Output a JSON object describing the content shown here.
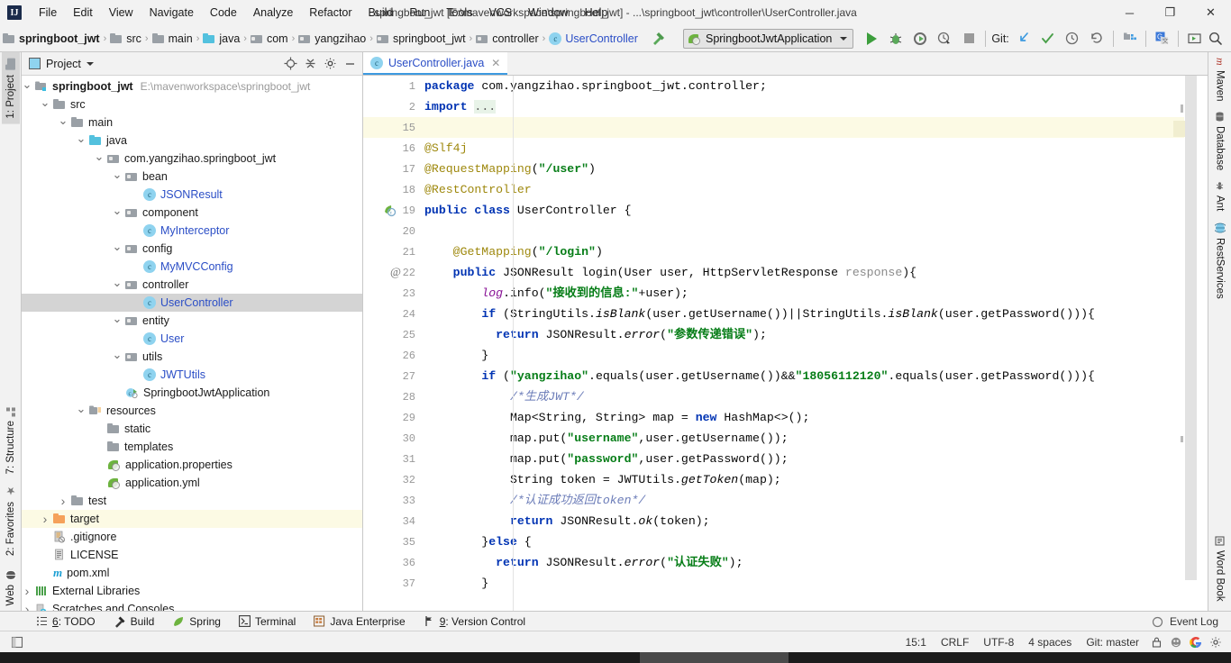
{
  "window": {
    "title": "springboot_jwt [E:\\mavenworkspace\\springboot_jwt] - ...\\springboot_jwt\\controller\\UserController.java",
    "minimize": "─",
    "maximize": "❐",
    "close": "✕",
    "logo": "IJ"
  },
  "menubar": {
    "items": [
      {
        "label": "File",
        "mnemonic": "F"
      },
      {
        "label": "Edit",
        "mnemonic": "E"
      },
      {
        "label": "View",
        "mnemonic": "V"
      },
      {
        "label": "Navigate",
        "mnemonic": "N"
      },
      {
        "label": "Code",
        "mnemonic": "C"
      },
      {
        "label": "Analyze",
        "mnemonic": "z"
      },
      {
        "label": "Refactor",
        "mnemonic": "R"
      },
      {
        "label": "Build",
        "mnemonic": "B"
      },
      {
        "label": "Run",
        "mnemonic": "u"
      },
      {
        "label": "Tools",
        "mnemonic": "T"
      },
      {
        "label": "VCS",
        "mnemonic": "S"
      },
      {
        "label": "Window",
        "mnemonic": "W"
      },
      {
        "label": "Help",
        "mnemonic": "H"
      }
    ]
  },
  "breadcrumbs": [
    {
      "label": "springboot_jwt",
      "icon": "folder-project-icon",
      "style": "bold"
    },
    {
      "label": "src",
      "icon": "folder-icon",
      "style": "normal"
    },
    {
      "label": "main",
      "icon": "folder-icon",
      "style": "normal"
    },
    {
      "label": "java",
      "icon": "folder-source-icon",
      "style": "normal"
    },
    {
      "label": "com",
      "icon": "package-icon",
      "style": "normal"
    },
    {
      "label": "yangzihao",
      "icon": "package-icon",
      "style": "normal"
    },
    {
      "label": "springboot_jwt",
      "icon": "package-icon",
      "style": "normal"
    },
    {
      "label": "controller",
      "icon": "package-icon",
      "style": "normal"
    },
    {
      "label": "UserController",
      "icon": "class-icon",
      "style": "blue"
    }
  ],
  "toolbar": {
    "run_config": "SpringbootJwtApplication",
    "git_label": "Git:",
    "buttons": [
      {
        "name": "build-hammer-icon",
        "title": "Build"
      },
      {
        "name": "run-button",
        "title": "Run"
      },
      {
        "name": "debug-button",
        "title": "Debug"
      },
      {
        "name": "run-with-coverage-button",
        "title": "Run with Coverage"
      },
      {
        "name": "profile-button",
        "title": "Profile"
      },
      {
        "name": "stop-button",
        "title": "Stop"
      },
      {
        "name": "git-update-project-icon",
        "title": "Update Project"
      },
      {
        "name": "git-commit-icon",
        "title": "Commit"
      },
      {
        "name": "git-history-icon",
        "title": "History"
      },
      {
        "name": "git-rollback-icon",
        "title": "Rollback"
      },
      {
        "name": "project-structure-icon",
        "title": "Project Structure"
      },
      {
        "name": "translate-icon",
        "title": "Translate"
      },
      {
        "name": "presentation-icon",
        "title": "Presentation"
      },
      {
        "name": "search-everywhere-icon",
        "title": "Search Everywhere"
      }
    ]
  },
  "left_rail": {
    "top": [
      {
        "label": "1: Project",
        "mnemonic": "1",
        "icon": "project-folder-icon",
        "selected": true
      }
    ],
    "bottom": [
      {
        "label": "7: Structure",
        "mnemonic": "7",
        "icon": "structure-icon"
      },
      {
        "label": "2: Favorites",
        "mnemonic": "2",
        "icon": "star-icon"
      },
      {
        "label": "Web",
        "icon": "web-globe-icon"
      }
    ]
  },
  "right_rail": {
    "items": [
      {
        "label": "Maven",
        "icon": "maven-icon"
      },
      {
        "label": "Database",
        "icon": "database-icon"
      },
      {
        "label": "Ant",
        "icon": "ant-icon"
      },
      {
        "label": "RestServices",
        "icon": "rest-services-icon"
      },
      {
        "label": "Word Book",
        "icon": "word-book-icon"
      }
    ]
  },
  "project_pane": {
    "title": "Project",
    "header_buttons": [
      {
        "name": "scroll-from-source-icon"
      },
      {
        "name": "collapse-all-icon"
      },
      {
        "name": "settings-gear-icon"
      },
      {
        "name": "hide-icon"
      }
    ],
    "tree": [
      {
        "label": "springboot_jwt",
        "path": "E:\\mavenworkspace\\springboot_jwt",
        "depth": 0,
        "arrow": "d",
        "icon": "module-icon",
        "bold": true
      },
      {
        "label": "src",
        "depth": 1,
        "arrow": "d",
        "icon": "folder-icon"
      },
      {
        "label": "main",
        "depth": 2,
        "arrow": "d",
        "icon": "folder-icon"
      },
      {
        "label": "java",
        "depth": 3,
        "arrow": "d",
        "icon": "folder-source-icon"
      },
      {
        "label": "com.yangzihao.springboot_jwt",
        "depth": 4,
        "arrow": "d",
        "icon": "package-icon"
      },
      {
        "label": "bean",
        "depth": 5,
        "arrow": "d",
        "icon": "package-icon"
      },
      {
        "label": "JSONResult",
        "depth": 6,
        "arrow": "",
        "icon": "class-icon",
        "blue": true
      },
      {
        "label": "component",
        "depth": 5,
        "arrow": "d",
        "icon": "package-icon"
      },
      {
        "label": "MyInterceptor",
        "depth": 6,
        "arrow": "",
        "icon": "class-icon",
        "blue": true
      },
      {
        "label": "config",
        "depth": 5,
        "arrow": "d",
        "icon": "package-icon"
      },
      {
        "label": "MyMVCConfig",
        "depth": 6,
        "arrow": "",
        "icon": "class-icon",
        "blue": true
      },
      {
        "label": "controller",
        "depth": 5,
        "arrow": "d",
        "icon": "package-icon"
      },
      {
        "label": "UserController",
        "depth": 6,
        "arrow": "",
        "icon": "class-icon",
        "blue": true,
        "selected": true
      },
      {
        "label": "entity",
        "depth": 5,
        "arrow": "d",
        "icon": "package-icon"
      },
      {
        "label": "User",
        "depth": 6,
        "arrow": "",
        "icon": "class-icon",
        "blue": true
      },
      {
        "label": "utils",
        "depth": 5,
        "arrow": "d",
        "icon": "package-icon"
      },
      {
        "label": "JWTUtils",
        "depth": 6,
        "arrow": "",
        "icon": "class-icon",
        "blue": true
      },
      {
        "label": "SpringbootJwtApplication",
        "depth": 5,
        "arrow": "",
        "icon": "spring-class-icon"
      },
      {
        "label": "resources",
        "depth": 3,
        "arrow": "d",
        "icon": "folder-resources-icon"
      },
      {
        "label": "static",
        "depth": 4,
        "arrow": "",
        "icon": "folder-icon"
      },
      {
        "label": "templates",
        "depth": 4,
        "arrow": "",
        "icon": "folder-icon"
      },
      {
        "label": "application.properties",
        "depth": 4,
        "arrow": "",
        "icon": "spring-config-icon"
      },
      {
        "label": "application.yml",
        "depth": 4,
        "arrow": "",
        "icon": "spring-config-icon"
      },
      {
        "label": "test",
        "depth": 2,
        "arrow": "r",
        "icon": "folder-icon"
      },
      {
        "label": "target",
        "depth": 1,
        "arrow": "r",
        "icon": "folder-excluded-icon",
        "highlight": true
      },
      {
        "label": ".gitignore",
        "depth": 1,
        "arrow": "",
        "icon": "gitignore-icon"
      },
      {
        "label": "LICENSE",
        "depth": 1,
        "arrow": "",
        "icon": "text-file-icon"
      },
      {
        "label": "pom.xml",
        "depth": 1,
        "arrow": "",
        "icon": "maven-pom-icon"
      },
      {
        "label": "External Libraries",
        "depth": 0,
        "arrow": "r",
        "icon": "libraries-icon"
      },
      {
        "label": "Scratches and Consoles",
        "depth": 0,
        "arrow": "r",
        "icon": "scratches-icon"
      }
    ]
  },
  "editor": {
    "tab": {
      "label": "UserController.java",
      "icon": "class-icon",
      "close": "✕"
    },
    "lines": [
      {
        "num": "1",
        "fold": "run",
        "html": "<span class='kw'>package</span> com.yangzihao.springboot_jwt.controller;"
      },
      {
        "num": "2",
        "fold": "plus",
        "html": "<span class='kw'>import</span> <span class='importdots'>...</span>"
      },
      {
        "num": "15",
        "fold": "",
        "html": "",
        "highlight": true
      },
      {
        "num": "16",
        "fold": "minus",
        "html": "<span class='ann'>@Slf4j</span>"
      },
      {
        "num": "17",
        "fold": "",
        "html": "<span class='ann'>@RequestMapping</span>(<span class='str'>\"/user\"</span>)"
      },
      {
        "num": "18",
        "fold": "minus",
        "html": "<span class='ann'>@RestController</span>"
      },
      {
        "num": "19",
        "fold": "",
        "gmark": "spring",
        "html": "<span class='kw'>public class</span> UserController {"
      },
      {
        "num": "20",
        "fold": "",
        "html": ""
      },
      {
        "num": "21",
        "fold": "",
        "html": "    <span class='ann'>@GetMapping</span>(<span class='str'>\"/login\"</span>)"
      },
      {
        "num": "22",
        "fold": "minus",
        "gmark": "at",
        "html": "    <span class='kw'>public</span> JSONResult login(User user, HttpServletResponse <span class='param'>response</span>){"
      },
      {
        "num": "23",
        "fold": "",
        "html": "        <span class='fld'>log</span>.info(<span class='str'>\"接收到的信息:\"</span>+user);"
      },
      {
        "num": "24",
        "fold": "minus",
        "html": "        <span class='kw'>if</span> (StringUtils.<span class='mth'>isBlank</span>(user.getUsername())||StringUtils.<span class='mth'>isBlank</span>(user.getPassword())){"
      },
      {
        "num": "25",
        "fold": "",
        "html": "          <span class='kw'>return</span> JSONResult.<span class='mth'>error</span>(<span class='str'>\"参数传递错误\"</span>);"
      },
      {
        "num": "26",
        "fold": "minus",
        "html": "        }"
      },
      {
        "num": "27",
        "fold": "minus",
        "html": "        <span class='kw'>if</span> (<span class='str'>\"yangzihao\"</span>.equals(user.getUsername())&amp;&amp;<span class='str'>\"18056112120\"</span>.equals(user.getPassword())){"
      },
      {
        "num": "28",
        "fold": "",
        "html": "            <span class='cmt2'>/*生成JWT*/</span>"
      },
      {
        "num": "29",
        "fold": "",
        "html": "            Map&lt;String, String&gt; map = <span class='kw'>new</span> HashMap&lt;&gt;();"
      },
      {
        "num": "30",
        "fold": "",
        "html": "            map.put(<span class='str'>\"username\"</span>,user.getUsername());"
      },
      {
        "num": "31",
        "fold": "",
        "html": "            map.put(<span class='str'>\"password\"</span>,user.getPassword());"
      },
      {
        "num": "32",
        "fold": "",
        "html": "            String token = JWTUtils.<span class='mth'>getToken</span>(map);"
      },
      {
        "num": "33",
        "fold": "",
        "html": "            <span class='cmt2'>/*认证成功返回token*/</span>"
      },
      {
        "num": "34",
        "fold": "",
        "html": "            <span class='kw'>return</span> JSONResult.<span class='mth'>ok</span>(token);"
      },
      {
        "num": "35",
        "fold": "minus",
        "html": "        }<span class='kw'>else</span> {"
      },
      {
        "num": "36",
        "fold": "",
        "html": "          <span class='kw'>return</span> JSONResult.<span class='mth'>error</span>(<span class='str'>\"认证失败\"</span>);"
      },
      {
        "num": "37",
        "fold": "minus",
        "html": "        }"
      }
    ]
  },
  "bottom_bar": {
    "items": [
      {
        "label": "6: TODO",
        "mnemonic": "6",
        "icon": "todo-icon"
      },
      {
        "label": "Build",
        "icon": "build-hammer-icon"
      },
      {
        "label": "Spring",
        "icon": "spring-leaf-icon"
      },
      {
        "label": "Terminal",
        "icon": "terminal-icon"
      },
      {
        "label": "Java Enterprise",
        "icon": "java-enterprise-icon"
      },
      {
        "label": "9: Version Control",
        "mnemonic": "9",
        "icon": "version-control-icon"
      }
    ]
  },
  "status_bar": {
    "event_log": "Event Log",
    "caret": "15:1",
    "line_separator": "CRLF",
    "encoding": "UTF-8",
    "indent": "4 spaces",
    "branch": "Git: master",
    "icons": [
      {
        "name": "lock-icon"
      },
      {
        "name": "inspection-icon"
      },
      {
        "name": "google-icon"
      },
      {
        "name": "settings-icon"
      }
    ]
  },
  "colors": {
    "accent_blue": "#2b4ec6",
    "tab_underline": "#3d9ae0",
    "highlight_line": "#fcfae4",
    "keyword": "#0033b3",
    "string": "#067d17",
    "annotation": "#9e880d",
    "comment": "#6b7cb8",
    "field": "#871094",
    "spring_green": "#6db33f",
    "marker_yellow": "#e8c20a",
    "selected_node": "#d4d4d4"
  }
}
